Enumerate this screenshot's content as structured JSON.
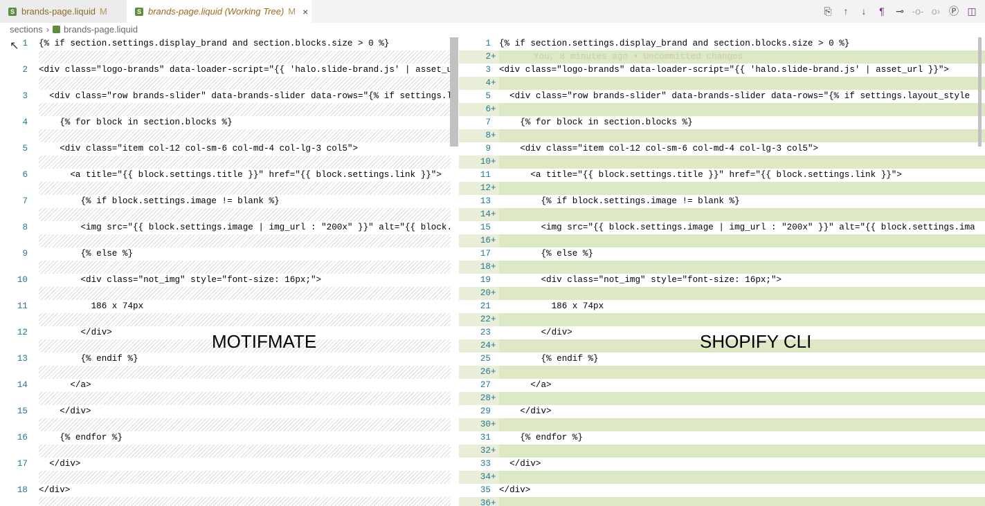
{
  "tabs": [
    {
      "label": "brands-page.liquid",
      "status": "M"
    },
    {
      "label": "brands-page.liquid (Working Tree)",
      "status": "M",
      "close": "×"
    }
  ],
  "toolbar_icons": [
    "open-file-icon",
    "previous-change-icon",
    "next-change-icon",
    "whitespace-icon",
    "git-compare-icon",
    "git-prev-icon",
    "git-next-icon",
    "git-lens-icon",
    "split-editor-icon"
  ],
  "breadcrumb": {
    "folder": "sections",
    "file": "brands-page.liquid"
  },
  "left_lines": [
    "{% if section.settings.display_brand and section.blocks.size > 0 %}",
    "<div class=\"logo-brands\" data-loader-script=\"{{ 'halo.slide-brand.js' | asset_u",
    "  <div class=\"row brands-slider\" data-brands-slider data-rows=\"{% if settings.l",
    "    {% for block in section.blocks %}",
    "    <div class=\"item col-12 col-sm-6 col-md-4 col-lg-3 col5\">",
    "      <a title=\"{{ block.settings.title }}\" href=\"{{ block.settings.link }}\">",
    "        {% if block.settings.image != blank %}",
    "        <img src=\"{{ block.settings.image | img_url : \"200x\" }}\" alt=\"{{ block.",
    "        {% else %}",
    "        <div class=\"not_img\" style=\"font-size: 16px;\">",
    "          186 x 74px",
    "        </div>",
    "        {% endif %}",
    "      </a>",
    "    </div>",
    "    {% endfor %}",
    "  </div>",
    "</div>"
  ],
  "right_lines": [
    "{% if section.settings.display_brand and section.blocks.size > 0 %}",
    "<div class=\"logo-brands\" data-loader-script=\"{{ 'halo.slide-brand.js' | asset_url }}\">",
    "  <div class=\"row brands-slider\" data-brands-slider data-rows=\"{% if settings.layout_style",
    "    {% for block in section.blocks %}",
    "    <div class=\"item col-12 col-sm-6 col-md-4 col-lg-3 col5\">",
    "      <a title=\"{{ block.settings.title }}\" href=\"{{ block.settings.link }}\">",
    "        {% if block.settings.image != blank %}",
    "        <img src=\"{{ block.settings.image | img_url : \"200x\" }}\" alt=\"{{ block.settings.ima",
    "        {% else %}",
    "        <div class=\"not_img\" style=\"font-size: 16px;\">",
    "          186 x 74px",
    "        </div>",
    "        {% endif %}",
    "      </a>",
    "    </div>",
    "    {% endfor %}",
    "  </div>",
    "</div>"
  ],
  "blame": "You, 8 minutes ago • Uncommitted changes",
  "overlay_labels": {
    "left": "MOTIFMATE",
    "right": "SHOPIFY CLI"
  }
}
